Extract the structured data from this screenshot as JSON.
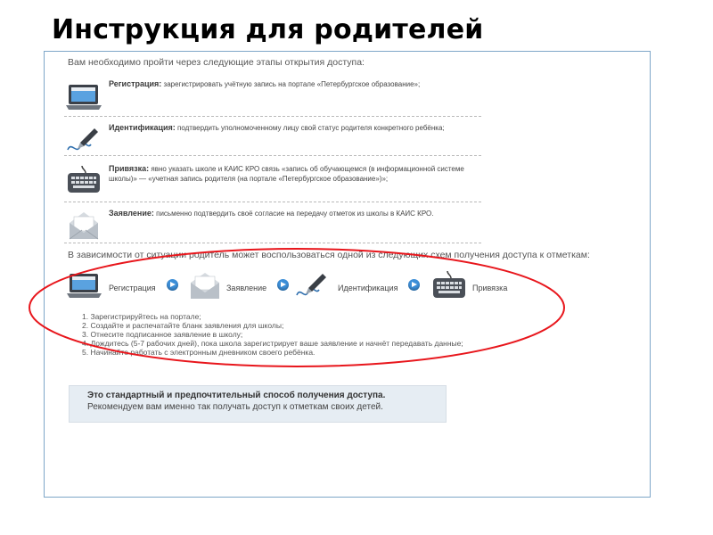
{
  "title": "Инструкция для родителей",
  "intro": "Вам необходимо пройти через следующие этапы открытия доступа:",
  "steps": [
    {
      "icon": "laptop-icon",
      "name": "Регистрация:",
      "text": "зарегистрировать учётную запись на портале «Петербургское образование»;"
    },
    {
      "icon": "pen-signature-icon",
      "name": "Идентификация:",
      "text": "подтвердить уполномоченному лицу свой статус родителя конкретного ребёнка;"
    },
    {
      "icon": "keyboard-icon",
      "name": "Привязка:",
      "text": "явно указать школе и КАИС КРО связь «запись об обучающемся (в информационной системе школы)» — «учетная запись родителя (на портале «Петербургское образование»)»;"
    },
    {
      "icon": "envelope-icon",
      "name": "Заявление:",
      "text": "письменно подтвердить своё согласие на передачу отметок из школы в КАИС КРО."
    }
  ],
  "lead": "В зависимости от ситуации родитель может воспользоваться одной из следующих схем получения доступа к отметкам:",
  "flow": [
    "Регистрация",
    "Заявление",
    "Идентификация",
    "Привязка"
  ],
  "plan": [
    "1.  Зарегистрируйтесь на портале;",
    "2.  Создайте и распечатайте бланк заявления для школы;",
    "3.  Отнесите подписанное заявление в школу;",
    "4.  Дождитесь (5-7 рабочих дней), пока школа зарегистрирует ваше заявление и начнёт передавать данные;",
    "5.  Начинайте работать с электронным дневником своего ребёнка."
  ],
  "note": {
    "line1": "Это стандартный и предпочтительный способ получения доступа.",
    "line2": "Рекомендуем вам именно так получать доступ к отметкам своих детей."
  },
  "colors": {
    "panel_border": "#7ea6c8",
    "arrow": "#3d8fd8",
    "ellipse": "#e8161c",
    "note_bg": "#e6edf3"
  }
}
